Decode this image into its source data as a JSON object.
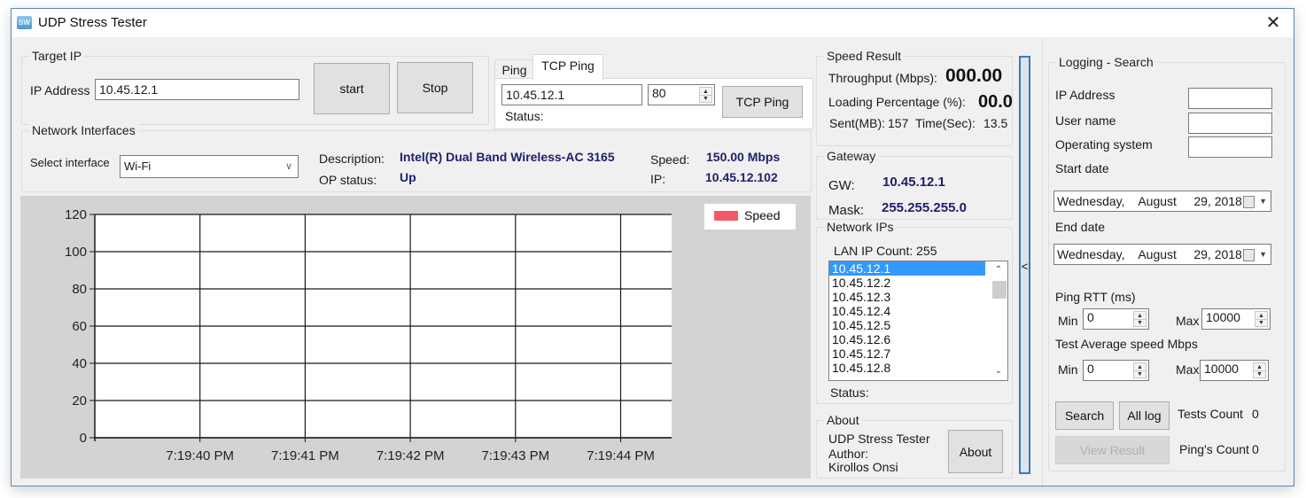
{
  "window": {
    "title": "UDP Stress Tester",
    "app_icon": "sw-app-icon",
    "close_glyph": "✕"
  },
  "target_ip": {
    "group_title": "Target IP",
    "ip_label": "IP Address",
    "ip_value": "10.45.12.1",
    "start_label": "start",
    "stop_label": "Stop"
  },
  "ping_tabs": {
    "tabs": [
      {
        "label": "Ping",
        "active": false
      },
      {
        "label": "TCP Ping",
        "active": true
      }
    ],
    "host_value": "10.45.12.1",
    "port_value": "80",
    "tcp_ping_label": "TCP Ping",
    "status_label": "Status:"
  },
  "network_interfaces": {
    "group_title": "Network Interfaces",
    "select_label": "Select interface",
    "selected_interface": "Wi-Fi",
    "description_label": "Description:",
    "description_value": "Intel(R) Dual Band Wireless-AC 3165",
    "op_status_label": "OP status:",
    "op_status_value": "Up",
    "speed_label": "Speed:",
    "speed_value": "150.00 Mbps",
    "ip_label": "IP:",
    "ip_value": "10.45.12.102"
  },
  "chart_data": {
    "type": "line",
    "title": "",
    "xlabel": "",
    "ylabel": "",
    "ylim": [
      0,
      120
    ],
    "y_ticks": [
      "0",
      "20",
      "40",
      "60",
      "80",
      "100",
      "120"
    ],
    "x_ticks": [
      "7:19:40 PM",
      "7:19:41 PM",
      "7:19:42 PM",
      "7:19:43 PM",
      "7:19:44 PM"
    ],
    "grid": true,
    "legend_position": "top-right",
    "series": [
      {
        "name": "Speed",
        "color": "#f15b67",
        "values": []
      }
    ]
  },
  "speed_result": {
    "group_title": "Speed Result",
    "throughput_label": "Throughput (Mbps):",
    "throughput_value": "000.00",
    "loading_label": "Loading Percentage (%):",
    "loading_value": "00.0",
    "sent_label": "Sent(MB):",
    "sent_value": "157",
    "time_label": "Time(Sec):",
    "time_value": "13.5"
  },
  "gateway": {
    "group_title": "Gateway",
    "gw_label": "GW:",
    "gw_value": "10.45.12.1",
    "mask_label": "Mask:",
    "mask_value": "255.255.255.0"
  },
  "network_ips": {
    "group_title": "Network IPs",
    "count_label": "LAN IP Count: 255",
    "items": [
      "10.45.12.1",
      "10.45.12.2",
      "10.45.12.3",
      "10.45.12.4",
      "10.45.12.5",
      "10.45.12.6",
      "10.45.12.7",
      "10.45.12.8"
    ],
    "selected_index": 0,
    "status_label": "Status:"
  },
  "about": {
    "group_title": "About",
    "app_name": "UDP Stress Tester",
    "author_label": "Author:",
    "author_name": "Kirollos Onsi",
    "about_button": "About"
  },
  "panel_toggle": {
    "glyph": "<"
  },
  "logging": {
    "group_title": "Logging - Search",
    "ip_label": "IP Address",
    "ip_value": "",
    "user_label": "User name",
    "user_value": "",
    "os_label": "Operating system",
    "os_value": "",
    "start_date_label": "Start date",
    "start_date_value": "Wednesday,    August     29, 2018",
    "end_date_label": "End date",
    "end_date_value": "Wednesday,    August     29, 2018",
    "ping_rtt_label": "Ping RTT (ms)",
    "rtt_min_label": "Min",
    "rtt_min_value": "0",
    "rtt_max_label": "Max",
    "rtt_max_value": "10000",
    "avg_speed_label": "Test Average speed Mbps",
    "speed_min_label": "Min",
    "speed_min_value": "0",
    "speed_max_label": "Max",
    "speed_max_value": "10000",
    "search_button": "Search",
    "all_log_button": "All log",
    "view_result_button": "View Result",
    "tests_count_label": "Tests Count",
    "tests_count_value": "0",
    "pings_count_label": "Ping's Count",
    "pings_count_value": "0"
  }
}
